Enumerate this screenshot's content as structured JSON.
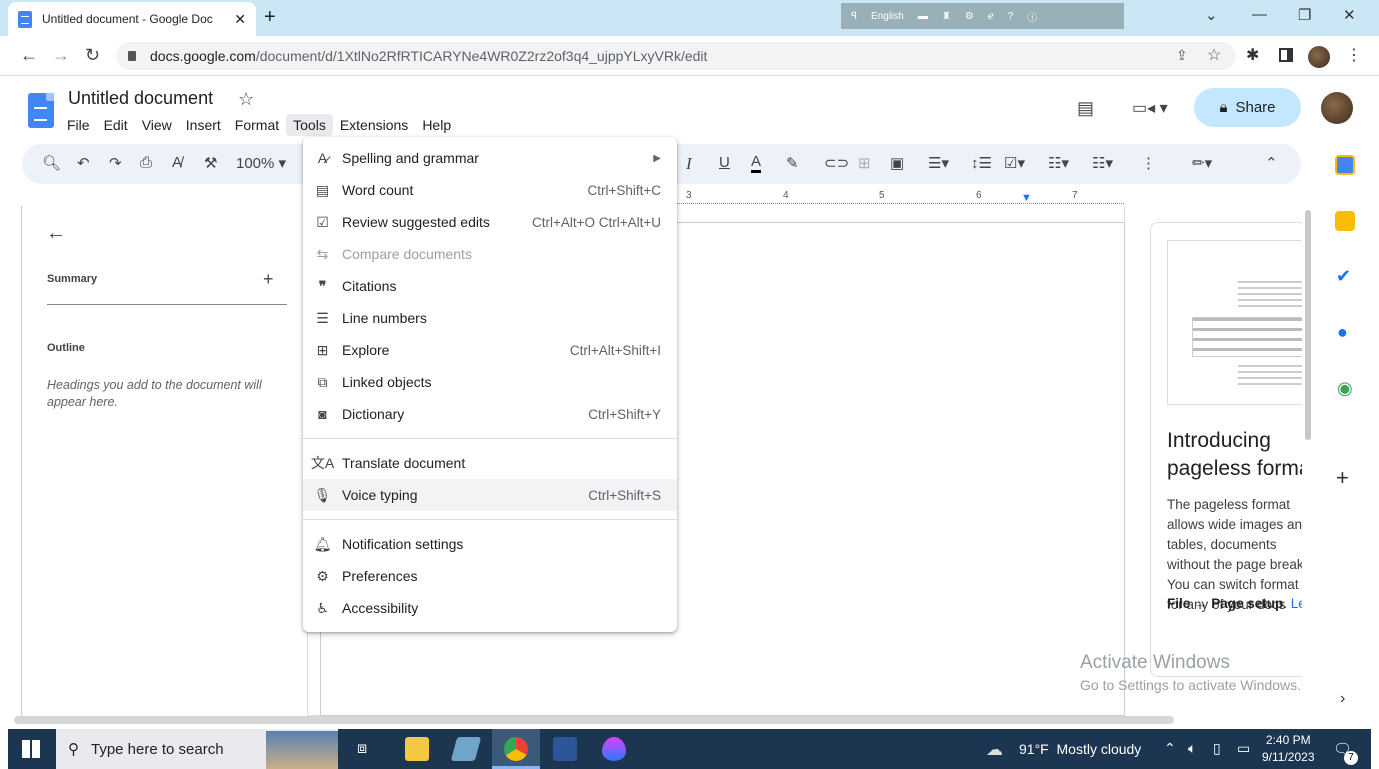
{
  "browser": {
    "tab_title": "Untitled document - Google Doc",
    "url_host": "docs.google.com",
    "url_path": "/document/d/1XtlNo2RfRTICARYNe4WR0Z2rz2of3q4_ujppYLxyVRk/edit",
    "ime_lang": "English"
  },
  "docs": {
    "title": "Untitled document",
    "menus": [
      "File",
      "Edit",
      "View",
      "Insert",
      "Format",
      "Tools",
      "Extensions",
      "Help"
    ],
    "share_label": "Share",
    "zoom": "100%"
  },
  "outline": {
    "summary": "Summary",
    "outline": "Outline",
    "hint": "Headings you add to the document will appear here."
  },
  "tools_menu": {
    "items": [
      {
        "label": "Spelling and grammar",
        "shortcut": "",
        "icon": "spellcheck-icon"
      },
      {
        "label": "Word count",
        "shortcut": "Ctrl+Shift+C",
        "icon": "word-count-icon"
      },
      {
        "label": "Review suggested edits",
        "shortcut": "Ctrl+Alt+O Ctrl+Alt+U",
        "icon": "review-edits-icon"
      },
      {
        "label": "Compare documents",
        "shortcut": "",
        "icon": "compare-icon"
      },
      {
        "label": "Citations",
        "shortcut": "",
        "icon": "quote-icon"
      },
      {
        "label": "Line numbers",
        "shortcut": "",
        "icon": "line-numbers-icon"
      },
      {
        "label": "Explore",
        "shortcut": "Ctrl+Alt+Shift+I",
        "icon": "explore-icon"
      },
      {
        "label": "Linked objects",
        "shortcut": "",
        "icon": "link-objects-icon"
      },
      {
        "label": "Dictionary",
        "shortcut": "Ctrl+Shift+Y",
        "icon": "dictionary-icon"
      },
      {
        "label": "Translate document",
        "shortcut": "",
        "icon": "translate-icon"
      },
      {
        "label": "Voice typing",
        "shortcut": "Ctrl+Shift+S",
        "icon": "mic-icon"
      },
      {
        "label": "Notification settings",
        "shortcut": "",
        "icon": "bell-icon"
      },
      {
        "label": "Preferences",
        "shortcut": "",
        "icon": "preferences-icon"
      },
      {
        "label": "Accessibility",
        "shortcut": "",
        "icon": "accessibility-icon"
      }
    ]
  },
  "promo": {
    "heading": "Introducing pageless format",
    "body": "The pageless format allows wide images and tables, documents without the page breaks. You can switch format for any of your docs",
    "path": "File → Page setup",
    "link": "Learn more"
  },
  "watermark": {
    "line1": "Activate Windows",
    "line2": "Go to Settings to activate Windows."
  },
  "ruler": [
    "3",
    "4",
    "5",
    "6",
    "7"
  ],
  "taskbar": {
    "search_placeholder": "Type here to search",
    "weather": "91°F  Mostly cloudy",
    "time": "2:40 PM",
    "date": "9/11/2023",
    "notifications": "7"
  }
}
